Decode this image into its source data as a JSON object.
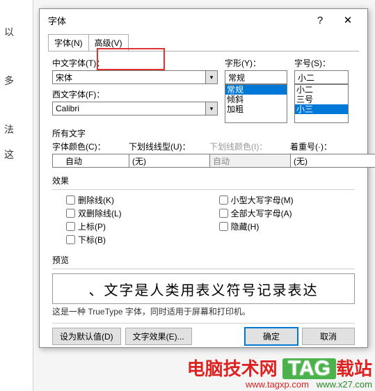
{
  "left_edge": {
    "t1": "以",
    "t2": "多",
    "t3": "法",
    "t4": "这"
  },
  "dialog": {
    "title": "字体",
    "tabs": {
      "font": "字体(N)",
      "advanced": "高级(V)"
    },
    "cn_font_label": "中文字体(T)：",
    "cn_font_value": "宋体",
    "west_font_label": "西文字体(F)：",
    "west_font_value": "Calibri",
    "style_label": "字形(Y)：",
    "style_value": "常规",
    "style_list": [
      "常规",
      "倾斜",
      "加粗"
    ],
    "size_label": "字号(S)：",
    "size_value": "小二",
    "size_list": [
      "小二",
      "三号",
      "小三"
    ],
    "all_text": "所有文字",
    "font_color_label": "字体颜色(C)：",
    "font_color_value": "自动",
    "underline_label": "下划线线型(U)：",
    "underline_value": "(无)",
    "underline_color_label": "下划线颜色(I)：",
    "underline_color_value": "自动",
    "emphasis_label": "着重号(·)：",
    "emphasis_value": "(无)",
    "effects": "效果",
    "chk_strike": "删除线(K)",
    "chk_dstrike": "双删除线(L)",
    "chk_super": "上标(P)",
    "chk_sub": "下标(B)",
    "chk_smallcaps": "小型大写字母(M)",
    "chk_allcaps": "全部大写字母(A)",
    "chk_hidden": "隐藏(H)",
    "preview_label": "预览",
    "preview_text": "、文字是人类用表义符号记录表达",
    "hint": "这是一种 TrueType 字体，同时适用于屏幕和打印机。",
    "btn_default": "设为默认值(D)",
    "btn_effects": "文字效果(E)...",
    "btn_ok": "确定",
    "btn_cancel": "取消"
  },
  "watermark": {
    "line1a": "电脑技术网",
    "tag": "TAG",
    "suffix": "载站",
    "url1": "www.tagxp.com",
    "url2": "www.x27.com"
  }
}
